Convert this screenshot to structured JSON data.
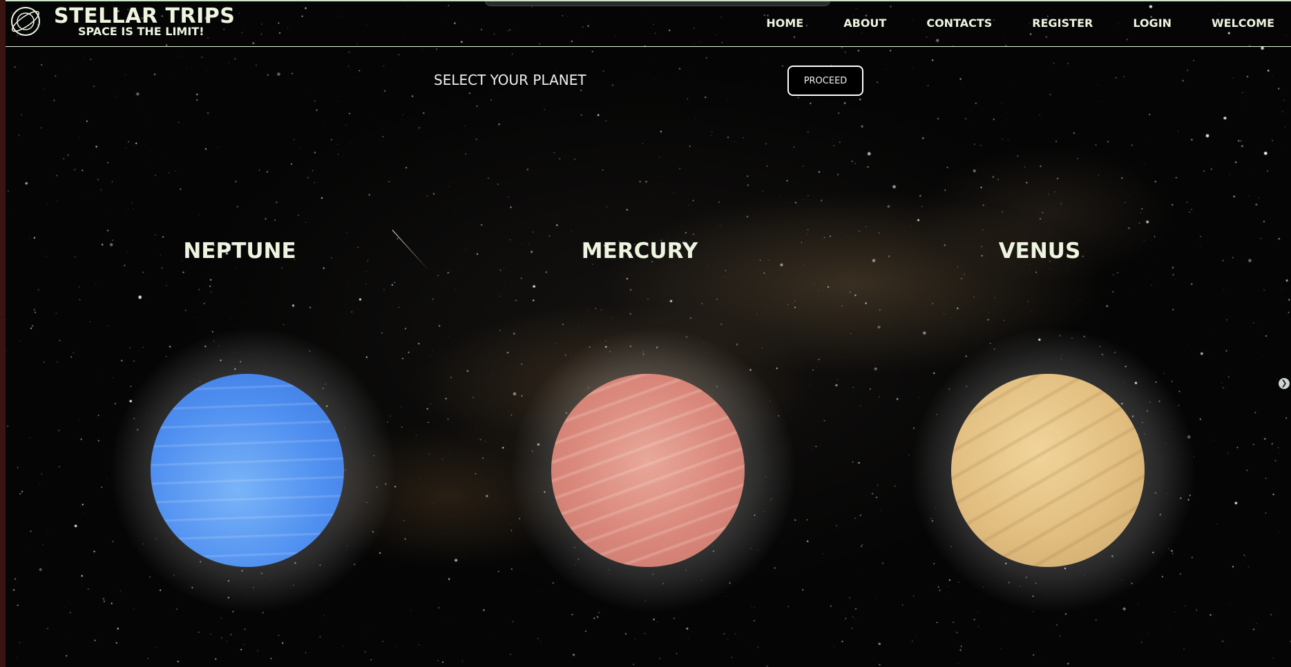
{
  "brand": {
    "title": "STELLAR TRIPS",
    "tagline": "SPACE IS THE LIMIT!",
    "logo_icon": "planet-ring-icon"
  },
  "nav": {
    "items": [
      {
        "label": "HOME"
      },
      {
        "label": "ABOUT"
      },
      {
        "label": "CONTACTS"
      },
      {
        "label": "REGISTER"
      },
      {
        "label": "LOGIN"
      },
      {
        "label": "WELCOME"
      }
    ]
  },
  "selector": {
    "label": "SELECT YOUR PLANET",
    "proceed_label": "PROCEED"
  },
  "planets": [
    {
      "name": "NEPTUNE",
      "color": "#5a9cf2"
    },
    {
      "name": "MERCURY",
      "color": "#de9486"
    },
    {
      "name": "VENUS",
      "color": "#e6c283"
    }
  ],
  "colors": {
    "text": "#edf5e0",
    "background": "#000000"
  },
  "icons": {
    "scroll_arrow": "chevron-right-icon"
  }
}
